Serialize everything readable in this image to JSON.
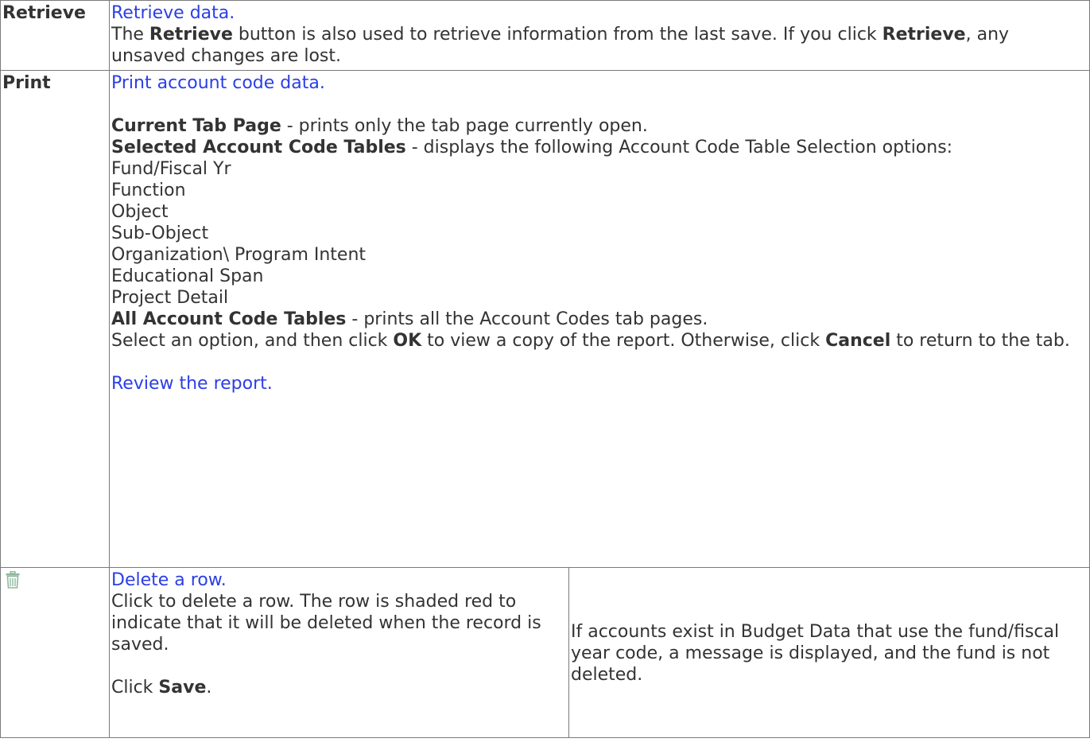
{
  "retrieve": {
    "label": "Retrieve",
    "link": "Retrieve data.",
    "desc_pre": "The ",
    "desc_bold": "Retrieve",
    "desc_mid": " button is also used to retrieve information from the last save. If you click ",
    "desc_bold2": "Retrieve",
    "desc_post": ", any unsaved changes are lost."
  },
  "print": {
    "label": "Print",
    "link": "Print account code data.",
    "current_tab_bold": "Current Tab Page",
    "current_tab_text": " - prints only the tab page currently open.",
    "selected_bold": "Selected Account Code Tables",
    "selected_text": " - displays the following Account Code Table Selection options:",
    "options": [
      "Fund/Fiscal Yr",
      "Function",
      "Object",
      "Sub-Object",
      "Organization\\ Program Intent",
      "Educational Span",
      "Project Detail"
    ],
    "all_bold": "All Account Code Tables",
    "all_text": " - prints all the Account Codes tab pages.",
    "select_pre": "Select an option, and then click ",
    "select_ok": "OK",
    "select_mid": " to view a copy of the report. Otherwise, click ",
    "select_cancel": "Cancel",
    "select_post": " to return to the tab.",
    "review_link": "Review the report."
  },
  "delete": {
    "icon": "trash-icon",
    "link": "Delete a row.",
    "desc": "Click to delete a row. The row is shaded red to indicate that it will be deleted when the record is saved.",
    "click_pre": "Click ",
    "click_bold": "Save",
    "click_post": ".",
    "note": "If accounts exist in Budget Data that use the fund/fiscal year code, a message is displayed, and the fund is not deleted."
  },
  "colors": {
    "link": "#2b3ee6",
    "text": "#333333",
    "border": "#7a7a7a",
    "icon": "#8fb8a0"
  }
}
